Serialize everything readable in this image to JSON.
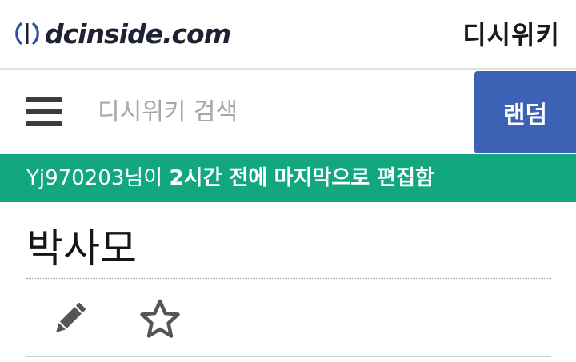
{
  "header": {
    "logo_text": "dcinside.com",
    "site_title": "디시위키"
  },
  "search": {
    "placeholder": "디시위키 검색",
    "menu_icon": "hamburger-menu-icon",
    "random_label": "랜덤"
  },
  "notice": {
    "user": "Yj970203",
    "suffix": "님이",
    "time": "2시간 전에",
    "action": "마지막으로 편집함"
  },
  "article": {
    "title": "박사모"
  },
  "tools": {
    "edit_icon": "pencil-icon",
    "favorite_icon": "star-icon"
  },
  "colors": {
    "brand_blue": "#3d62b5",
    "notice_green": "#12a77f",
    "logo_dark": "#1f2233"
  }
}
